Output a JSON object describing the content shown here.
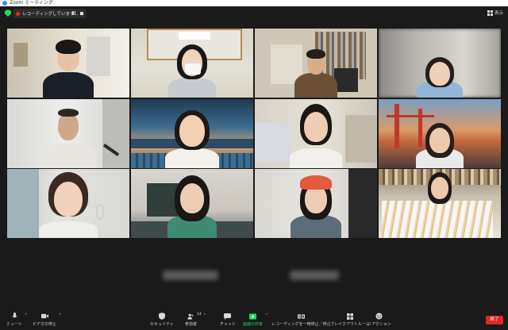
{
  "window": {
    "title": "Zoom ミーティング"
  },
  "topbar": {
    "recording_text": "レコーディングしています...",
    "view_label": "表示"
  },
  "toolbar": {
    "mute": "ミュート",
    "video": "ビデオの停止",
    "security": "セキュリティ",
    "participants": "参加者",
    "participants_count": "14",
    "chat": "チャット",
    "share": "画面の共有",
    "recording": "レコーディングを一時停止／停止",
    "breakout": "ブレイクアウトルーム",
    "reactions": "リアクション",
    "leave": "終了"
  },
  "icons": {
    "shield": "security-shield-icon",
    "mic": "microphone-icon",
    "video": "video-camera-icon"
  },
  "colors": {
    "accent_green": "#23d959",
    "active_speaker": "#9ed13a",
    "leave_red": "#e02828",
    "share_green": "#23d959"
  }
}
